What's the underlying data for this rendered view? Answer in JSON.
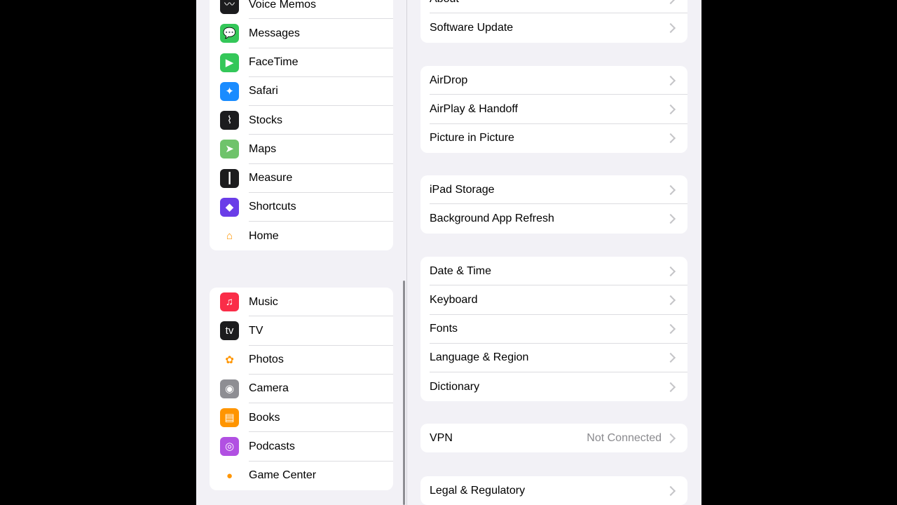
{
  "sidebar": {
    "group1": [
      {
        "label": "Voice Memos",
        "icon": "waveform-icon",
        "color": "#1c1c1e",
        "glyph": "〰"
      },
      {
        "label": "Messages",
        "icon": "message-bubble-icon",
        "color": "#34c759",
        "glyph": "💬"
      },
      {
        "label": "FaceTime",
        "icon": "video-camera-icon",
        "color": "#34c759",
        "glyph": "▶"
      },
      {
        "label": "Safari",
        "icon": "compass-icon",
        "color": "#1a8cff",
        "glyph": "✦"
      },
      {
        "label": "Stocks",
        "icon": "stock-chart-icon",
        "color": "#1c1c1e",
        "glyph": "⌇"
      },
      {
        "label": "Maps",
        "icon": "map-icon",
        "color": "#6fc36b",
        "glyph": "➤"
      },
      {
        "label": "Measure",
        "icon": "ruler-icon",
        "color": "#1c1c1e",
        "glyph": "┃"
      },
      {
        "label": "Shortcuts",
        "icon": "shortcuts-icon",
        "color": "#6a3de8",
        "glyph": "◆"
      },
      {
        "label": "Home",
        "icon": "house-icon",
        "color": "#ffffff",
        "glyph": "⌂"
      }
    ],
    "group2": [
      {
        "label": "Music",
        "icon": "music-note-icon",
        "color": "#fa2d48",
        "glyph": "♫"
      },
      {
        "label": "TV",
        "icon": "apple-tv-icon",
        "color": "#1c1c1e",
        "glyph": "tv"
      },
      {
        "label": "Photos",
        "icon": "photos-flower-icon",
        "color": "#ffffff",
        "glyph": "✿"
      },
      {
        "label": "Camera",
        "icon": "camera-icon",
        "color": "#8e8e93",
        "glyph": "◉"
      },
      {
        "label": "Books",
        "icon": "book-icon",
        "color": "#ff9500",
        "glyph": "▤"
      },
      {
        "label": "Podcasts",
        "icon": "podcast-icon",
        "color": "#b150e2",
        "glyph": "◎"
      },
      {
        "label": "Game Center",
        "icon": "game-center-icon",
        "color": "#ffffff",
        "glyph": "●"
      }
    ]
  },
  "detail": {
    "card1": [
      {
        "label": "About",
        "value": ""
      },
      {
        "label": "Software Update",
        "value": ""
      }
    ],
    "card2": [
      {
        "label": "AirDrop",
        "value": ""
      },
      {
        "label": "AirPlay & Handoff",
        "value": ""
      },
      {
        "label": "Picture in Picture",
        "value": ""
      }
    ],
    "card3": [
      {
        "label": "iPad Storage",
        "value": ""
      },
      {
        "label": "Background App Refresh",
        "value": ""
      }
    ],
    "card4": [
      {
        "label": "Date & Time",
        "value": ""
      },
      {
        "label": "Keyboard",
        "value": ""
      },
      {
        "label": "Fonts",
        "value": ""
      },
      {
        "label": "Language & Region",
        "value": ""
      },
      {
        "label": "Dictionary",
        "value": ""
      }
    ],
    "card5": [
      {
        "label": "VPN",
        "value": "Not Connected"
      }
    ],
    "card6": [
      {
        "label": "Legal & Regulatory",
        "value": ""
      }
    ]
  },
  "colors": {
    "background": "#f2f1f6",
    "chevron": "#c4c4c7",
    "secondary_text": "#8a8a8e"
  }
}
